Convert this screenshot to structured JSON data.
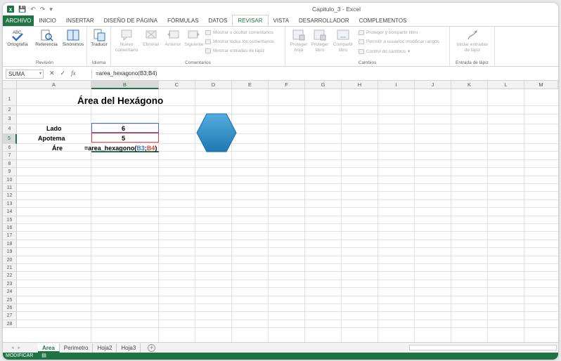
{
  "window": {
    "title": "Capitulo_3 - Excel",
    "logo": "excel-icon"
  },
  "tabs": [
    "ARCHIVO",
    "INICIO",
    "INSERTAR",
    "DISEÑO DE PÁGINA",
    "FÓRMULAS",
    "DATOS",
    "REVISAR",
    "VISTA",
    "DESARROLLADOR",
    "COMPLEMENTOS"
  ],
  "active_tab": "REVISAR",
  "ribbon": {
    "revision": {
      "label": "Revisión",
      "ortografia": "Ortografía",
      "referencia": "Referencia",
      "sinonimos": "Sinónimos"
    },
    "idioma": {
      "label": "Idioma",
      "traducir": "Traducir"
    },
    "comentarios": {
      "label": "Comentarios",
      "nuevo1": "Nuevo",
      "nuevo2": "comentario",
      "eliminar": "Eliminar",
      "anterior": "Anterior",
      "siguiente": "Siguiente",
      "mostrar_ocultar": "Mostrar u ocultar comentarios",
      "mostrar_todos": "Mostrar todos los comentarios",
      "mostrar_entradas": "Mostrar entradas de lápiz"
    },
    "cambios": {
      "label": "Cambios",
      "proteger_hoja1": "Proteger",
      "proteger_hoja2": "hoja",
      "proteger_libro1": "Proteger",
      "proteger_libro2": "libro",
      "compartir1": "Compartir",
      "compartir2": "libro",
      "proteger_compartir": "Proteger y compartir libro",
      "permitir_usuarios": "Permitir a usuarios modificar rangos",
      "control_cambios": "Control de cambios"
    },
    "lapiz": {
      "label": "Entrada de lápiz",
      "iniciar1": "Iniciar entradas",
      "iniciar2": "de lápiz"
    }
  },
  "formula_bar": {
    "name_box": "SUMA",
    "fx": "fx",
    "formula": "=area_hexagono(B3;B4)"
  },
  "columns": [
    "A",
    "B",
    "C",
    "D",
    "E",
    "F",
    "G",
    "H",
    "I",
    "J",
    "K",
    "L",
    "M"
  ],
  "selected_column": "B",
  "rows": [
    "1",
    "2",
    "3",
    "4",
    "5",
    "6",
    "7",
    "8",
    "9",
    "10",
    "11",
    "12",
    "13",
    "14",
    "15",
    "16",
    "17",
    "18",
    "19",
    "20",
    "21",
    "22",
    "23",
    "24",
    "25",
    "26",
    "27",
    "28"
  ],
  "selected_row": "5",
  "cells": {
    "title": "Área del Hexágono",
    "lado_label": "Lado",
    "lado_value": "6",
    "apotema_label": "Apotema",
    "apotema_value": "5",
    "area_label": "Áre",
    "edit_prefix": "=area_hexagono(",
    "edit_ref1": "B3",
    "edit_sep": ";",
    "edit_ref2": "B4",
    "edit_suffix": ")"
  },
  "shape": {
    "type": "hexagon",
    "color": "#2e8fc7"
  },
  "sheets": [
    "Area",
    "Perimetro",
    "Hoja2",
    "Hoja3"
  ],
  "active_sheet": "Area",
  "status": {
    "mode": "MODIFICAR"
  },
  "colors": {
    "accent": "#217346",
    "ref1": "#4472c4",
    "ref2": "#e0413a"
  }
}
